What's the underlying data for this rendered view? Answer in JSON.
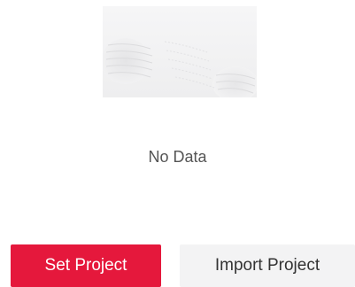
{
  "empty_state": {
    "illustration_icon": "no-data-illustration-icon",
    "message": "No Data"
  },
  "actions": {
    "set_project_label": "Set Project",
    "import_project_label": "Import Project"
  },
  "colors": {
    "primary": "#e5183c",
    "secondary_bg": "#f3f3f4",
    "message_text": "#555555"
  }
}
